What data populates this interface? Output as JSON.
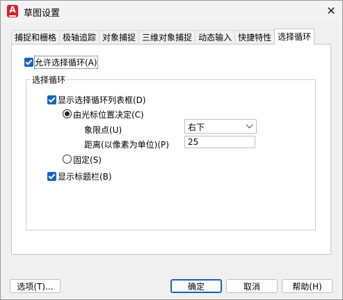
{
  "window": {
    "title": "草图设置",
    "app_icon_letter": "A",
    "close_glyph": "✕"
  },
  "tabs": [
    {
      "label": "捕捉和栅格",
      "active": false
    },
    {
      "label": "极轴追踪",
      "active": false
    },
    {
      "label": "对象捕捉",
      "active": false
    },
    {
      "label": "三维对象捕捉",
      "active": false
    },
    {
      "label": "动态输入",
      "active": false
    },
    {
      "label": "快捷特性",
      "active": false
    },
    {
      "label": "选择循环",
      "active": true
    }
  ],
  "panel": {
    "allow_selection_cycling": {
      "label": "允许选择循环(A)",
      "checked": true
    },
    "group": {
      "legend": "选择循环",
      "show_list_box": {
        "label": "显示选择循环列表框(D)",
        "checked": true
      },
      "by_cursor": {
        "label": "由光标位置决定(C)",
        "selected": true
      },
      "quadrant": {
        "label": "象限点(U)",
        "value": "右下"
      },
      "distance": {
        "label": "距离(以像素为单位)(P)",
        "value": "25"
      },
      "fixed": {
        "label": "固定(S)",
        "selected": false
      },
      "show_title_bar": {
        "label": "显示标题栏(B)",
        "checked": true
      }
    }
  },
  "buttons": {
    "options": "选项(T)...",
    "ok": "确定",
    "cancel": "取消",
    "help": "帮助(H)"
  },
  "colors": {
    "accent": "#1565c0",
    "app_icon": "#d7232d"
  }
}
